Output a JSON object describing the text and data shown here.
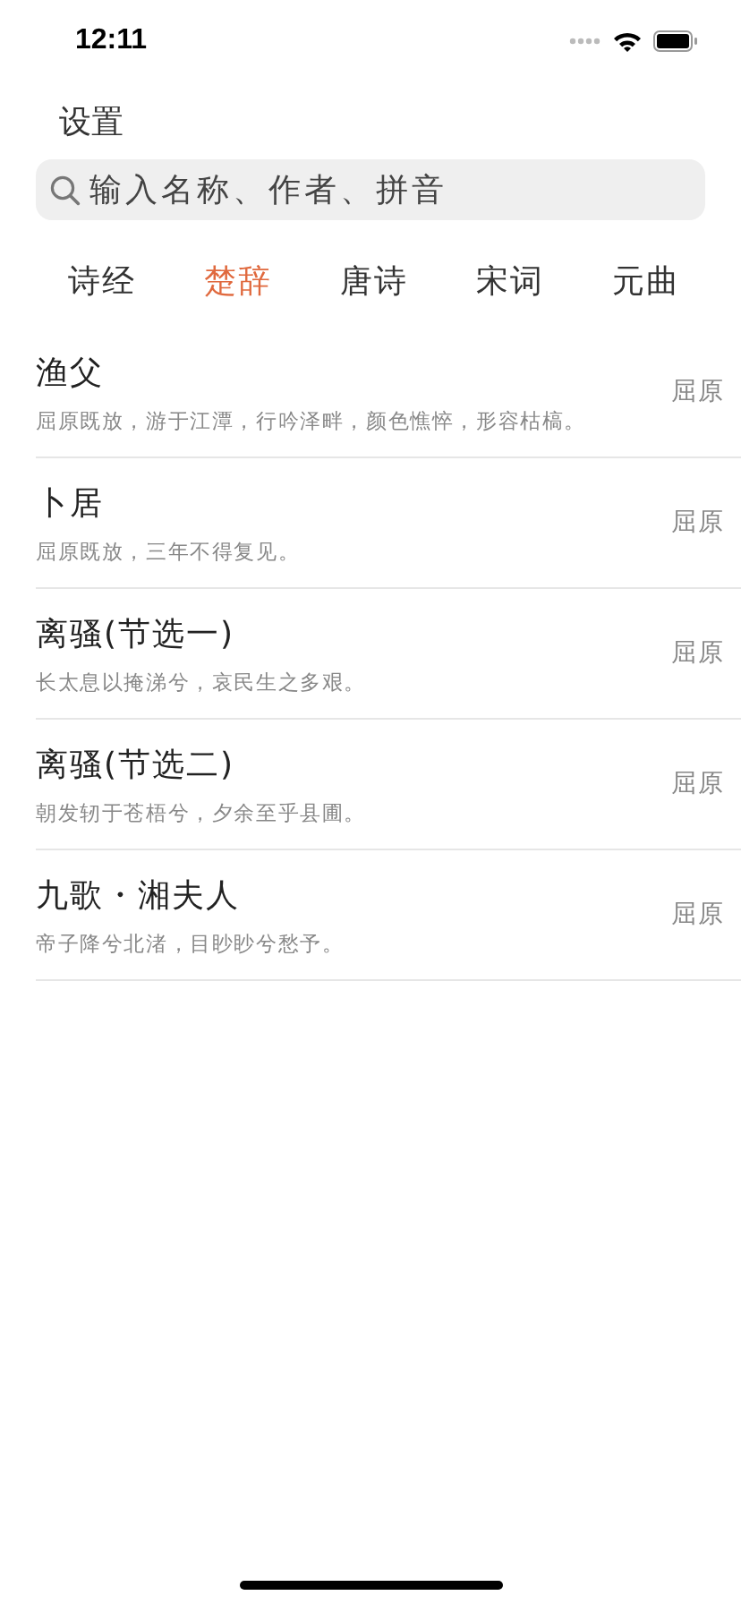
{
  "status_bar": {
    "time": "12:11"
  },
  "header": {
    "title": "设置"
  },
  "search": {
    "placeholder": "输入名称、作者、拼音"
  },
  "tabs": [
    {
      "label": "诗经",
      "selected": false
    },
    {
      "label": "楚辞",
      "selected": true
    },
    {
      "label": "唐诗",
      "selected": false
    },
    {
      "label": "宋词",
      "selected": false
    },
    {
      "label": "元曲",
      "selected": false
    }
  ],
  "poems": [
    {
      "title": "渔父",
      "excerpt": "屈原既放，游于江潭，行吟泽畔，颜色憔悴，形容枯槁。",
      "author": "屈原"
    },
    {
      "title": "卜居",
      "excerpt": "屈原既放，三年不得复见。",
      "author": "屈原"
    },
    {
      "title": "离骚(节选一)",
      "excerpt": "长太息以掩涕兮，哀民生之多艰。",
      "author": "屈原"
    },
    {
      "title": "离骚(节选二)",
      "excerpt": "朝发轫于苍梧兮，夕余至乎县圃。",
      "author": "屈原"
    },
    {
      "title": "九歌・湘夫人",
      "excerpt": "帝子降兮北渚，目眇眇兮愁予。",
      "author": "屈原"
    }
  ]
}
